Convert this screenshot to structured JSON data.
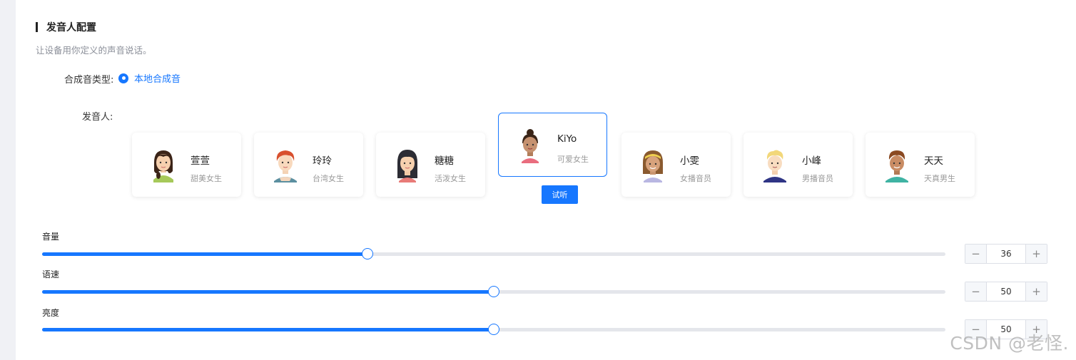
{
  "section": {
    "title": "发音人配置",
    "description": "让设备用你定义的声音说话。"
  },
  "synthesis": {
    "label": "合成音类型:",
    "option": "本地合成音",
    "accent_color": "#1677ff"
  },
  "speaker": {
    "label": "发音人:",
    "cards": [
      {
        "name": "萱萱",
        "desc": "甜美女生",
        "avatar_icon": "girl-braid-avatar-icon",
        "selected": false
      },
      {
        "name": "玲玲",
        "desc": "台湾女生",
        "avatar_icon": "girl-red-hair-avatar-icon",
        "selected": false
      },
      {
        "name": "糖糖",
        "desc": "活泼女生",
        "avatar_icon": "girl-long-hair-avatar-icon",
        "selected": false
      },
      {
        "name": "KiYo",
        "desc": "可爱女生",
        "avatar_icon": "girl-bun-avatar-icon",
        "selected": true
      },
      {
        "name": "小雯",
        "desc": "女播音员",
        "avatar_icon": "woman-headband-avatar-icon",
        "selected": false
      },
      {
        "name": "小峰",
        "desc": "男播音员",
        "avatar_icon": "man-blond-avatar-icon",
        "selected": false
      },
      {
        "name": "天天",
        "desc": "天真男生",
        "avatar_icon": "boy-brown-hair-avatar-icon",
        "selected": false
      }
    ],
    "try_label": "试听"
  },
  "sliders": [
    {
      "label": "音量",
      "value": "36",
      "fraction": 0.36
    },
    {
      "label": "语速",
      "value": "50",
      "fraction": 0.5
    },
    {
      "label": "亮度",
      "value": "50",
      "fraction": 0.5
    }
  ],
  "stepper_icons": {
    "minus": "−",
    "plus": "+"
  },
  "watermark": "CSDN @老怪."
}
